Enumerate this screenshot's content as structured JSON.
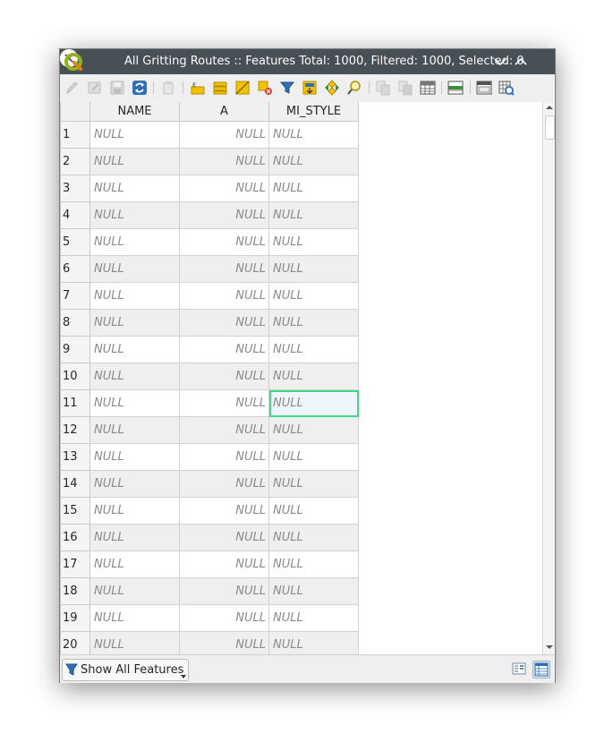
{
  "window": {
    "title": "All Gritting Routes :: Features Total: 1000, Filtered: 1000, Selected: 0"
  },
  "icons": {
    "app": "qgis-logo-icon",
    "titlebar": [
      "chevron-down-icon",
      "chevron-up-icon",
      "close-icon"
    ],
    "toolbar": [
      "toggle-editing-icon",
      "toggle-multi-edit-icon",
      "save-edits-icon",
      "reload-icon",
      "add-feature-icon",
      "delete-selected-icon",
      "select-by-expression-icon",
      "select-all-icon",
      "invert-selection-icon",
      "deselect-all-icon",
      "filter-select-icon",
      "move-selection-top-icon",
      "pan-to-selected-icon",
      "zoom-to-selected-icon",
      "copy-rows-icon",
      "paste-features-icon",
      "new-field-icon",
      "delete-field-icon",
      "field-calculator-icon",
      "conditional-formatting-icon",
      "dock-table-icon",
      "actions-icon"
    ]
  },
  "table": {
    "columns": [
      "NAME",
      "A",
      "MI_STYLE"
    ],
    "null_text": "NULL",
    "selected_cell": {
      "row": 11,
      "column": "MI_STYLE"
    },
    "rows": [
      {
        "id": "1",
        "name": "NULL",
        "a": "NULL",
        "mi_style": "NULL"
      },
      {
        "id": "2",
        "name": "NULL",
        "a": "NULL",
        "mi_style": "NULL"
      },
      {
        "id": "3",
        "name": "NULL",
        "a": "NULL",
        "mi_style": "NULL"
      },
      {
        "id": "4",
        "name": "NULL",
        "a": "NULL",
        "mi_style": "NULL"
      },
      {
        "id": "5",
        "name": "NULL",
        "a": "NULL",
        "mi_style": "NULL"
      },
      {
        "id": "6",
        "name": "NULL",
        "a": "NULL",
        "mi_style": "NULL"
      },
      {
        "id": "7",
        "name": "NULL",
        "a": "NULL",
        "mi_style": "NULL"
      },
      {
        "id": "8",
        "name": "NULL",
        "a": "NULL",
        "mi_style": "NULL"
      },
      {
        "id": "9",
        "name": "NULL",
        "a": "NULL",
        "mi_style": "NULL"
      },
      {
        "id": "10",
        "name": "NULL",
        "a": "NULL",
        "mi_style": "NULL"
      },
      {
        "id": "11",
        "name": "NULL",
        "a": "NULL",
        "mi_style": "NULL"
      },
      {
        "id": "12",
        "name": "NULL",
        "a": "NULL",
        "mi_style": "NULL"
      },
      {
        "id": "13",
        "name": "NULL",
        "a": "NULL",
        "mi_style": "NULL"
      },
      {
        "id": "14",
        "name": "NULL",
        "a": "NULL",
        "mi_style": "NULL"
      },
      {
        "id": "15",
        "name": "NULL",
        "a": "NULL",
        "mi_style": "NULL"
      },
      {
        "id": "16",
        "name": "NULL",
        "a": "NULL",
        "mi_style": "NULL"
      },
      {
        "id": "17",
        "name": "NULL",
        "a": "NULL",
        "mi_style": "NULL"
      },
      {
        "id": "18",
        "name": "NULL",
        "a": "NULL",
        "mi_style": "NULL"
      },
      {
        "id": "19",
        "name": "NULL",
        "a": "NULL",
        "mi_style": "NULL"
      },
      {
        "id": "20",
        "name": "NULL",
        "a": "NULL",
        "mi_style": "NULL"
      }
    ]
  },
  "statusbar": {
    "filter_label": "Show All Features",
    "view_buttons": [
      "form-view-icon",
      "table-view-icon"
    ],
    "active_view": "table-view-icon"
  },
  "colors": {
    "titlebar": "#475057",
    "selection_outline": "#3ddc84",
    "null_text": "#8a8a8a"
  }
}
